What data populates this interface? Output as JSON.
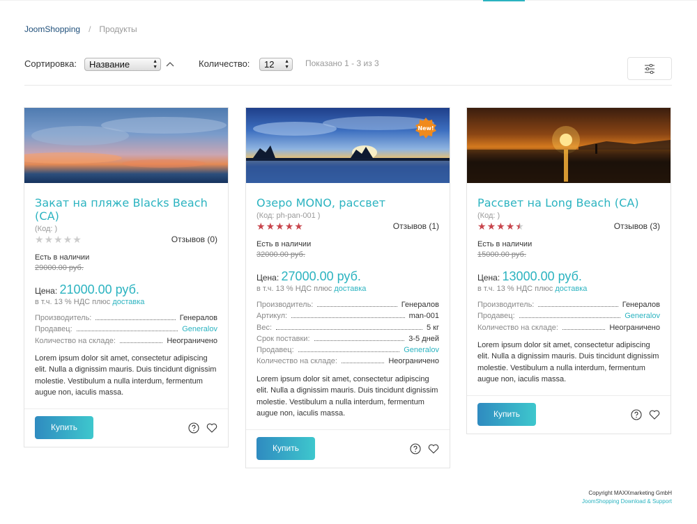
{
  "breadcrumb": {
    "home": "JoomShopping",
    "separator": "/",
    "current": "Продукты"
  },
  "toolbar": {
    "sort_label": "Сортировка:",
    "sort_value": "Название",
    "count_label": "Количество:",
    "count_value": "12",
    "shown_text": "Показано 1 - 3 из 3",
    "filter_icon": "sliders-icon"
  },
  "products": [
    {
      "name": "Закат на пляже Blacks Beach (CA)",
      "code": "(Код: )",
      "rating": 0,
      "reviews": "Отзывов (0)",
      "stock": "Есть в наличии",
      "old_price": "29000.00 руб.",
      "price_label": "Цена:",
      "price": "21000.00 руб.",
      "tax_text": "в т.ч. 13 % НДС плюс",
      "tax_link": "доставка",
      "attrs": [
        {
          "k": "Производитель:",
          "v": "Генералов",
          "link": false
        },
        {
          "k": "Продавец:",
          "v": "Generalov",
          "link": true
        },
        {
          "k": "Количество на складе:",
          "v": "Неограничено",
          "link": false
        }
      ],
      "desc": "Lorem ipsum dolor sit amet, consectetur adipiscing elit. Nulla a dignissim mauris. Duis tincidunt dignissim molestie. Vestibulum a nulla interdum, fermentum augue non, iaculis massa.",
      "buy": "Купить",
      "is_new": false
    },
    {
      "name": "Озеро MONO, рассвет",
      "code": "(Код: ph-pan-001 )",
      "rating": 5,
      "reviews": "Отзывов (1)",
      "stock": "Есть в наличии",
      "old_price": "32000.00 руб.",
      "price_label": "Цена:",
      "price": "27000.00 руб.",
      "tax_text": "в т.ч. 13 % НДС плюс",
      "tax_link": "доставка",
      "attrs": [
        {
          "k": "Производитель:",
          "v": "Генералов",
          "link": false
        },
        {
          "k": "Артикул:",
          "v": "man-001",
          "link": false
        },
        {
          "k": "Вес:",
          "v": "5 кг",
          "link": false
        },
        {
          "k": "Срок поставки:",
          "v": "3-5 дней",
          "link": false
        },
        {
          "k": "Продавец:",
          "v": "Generalov",
          "link": true
        },
        {
          "k": "Количество на складе:",
          "v": "Неограничено",
          "link": false
        }
      ],
      "desc": "Lorem ipsum dolor sit amet, consectetur adipiscing elit. Nulla a dignissim mauris. Duis tincidunt dignissim molestie. Vestibulum a nulla interdum, fermentum augue non, iaculis massa.",
      "buy": "Купить",
      "is_new": true,
      "badge": "New!"
    },
    {
      "name": "Рассвет на Long Beach (CA)",
      "code": "(Код: )",
      "rating": 4.5,
      "reviews": "Отзывов (3)",
      "stock": "Есть в наличии",
      "old_price": "15000.00 руб.",
      "price_label": "Цена:",
      "price": "13000.00 руб.",
      "tax_text": "в т.ч. 13 % НДС плюс",
      "tax_link": "доставка",
      "attrs": [
        {
          "k": "Производитель:",
          "v": "Генералов",
          "link": false
        },
        {
          "k": "Продавец:",
          "v": "Generalov",
          "link": true
        },
        {
          "k": "Количество на складе:",
          "v": "Неограничено",
          "link": false
        }
      ],
      "desc": "Lorem ipsum dolor sit amet, consectetur adipiscing elit. Nulla a dignissim mauris. Duis tincidunt dignissim molestie. Vestibulum a nulla interdum, fermentum augue non, iaculis massa.",
      "buy": "Купить",
      "is_new": false
    }
  ],
  "footer": {
    "copyright": "Copyright MAXXmarketing GmbH",
    "link": "JoomShopping Download & Support"
  },
  "colors": {
    "accent": "#2bb3c0",
    "star": "#c8454c",
    "button_from": "#2f8bc0",
    "button_to": "#3ec7cd"
  }
}
